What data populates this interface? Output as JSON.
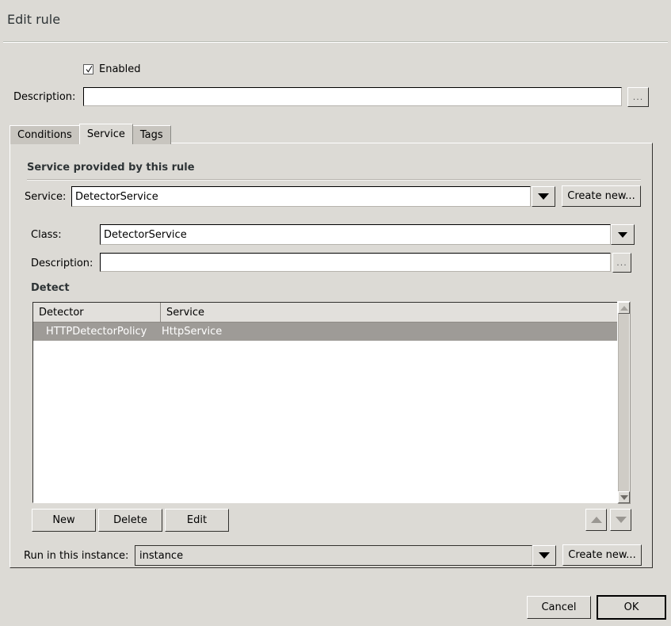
{
  "dialog": {
    "title": "Edit rule"
  },
  "header": {
    "enabled_label": "Enabled",
    "enabled_checked": true,
    "description_label": "Description:",
    "description_value": "",
    "description_browse_label": "...",
    "description_placeholder": ""
  },
  "tabs": [
    {
      "label": "Conditions",
      "active": false
    },
    {
      "label": "Service",
      "active": true
    },
    {
      "label": "Tags",
      "active": false
    }
  ],
  "service_tab": {
    "group_label": "Service provided by this rule",
    "service_label": "Service:",
    "service_value": "DetectorService",
    "service_create_new_label": "Create new...",
    "class_label": "Class:",
    "class_value": "DetectorService",
    "class_description_label": "Description:",
    "class_description_value": "",
    "class_description_browse_label": "...",
    "detect_label": "Detect",
    "detect_table": {
      "columns": [
        "Detector",
        "Service"
      ],
      "rows": [
        {
          "detector": "HTTPDetectorPolicy",
          "service": "HttpService",
          "selected": true
        }
      ]
    },
    "buttons": {
      "new_label": "New",
      "delete_label": "Delete",
      "edit_label": "Edit"
    },
    "instance_label": "Run in this instance:",
    "instance_value": "instance",
    "instance_create_new_label": "Create new..."
  },
  "footer": {
    "cancel_label": "Cancel",
    "ok_label": "OK"
  },
  "colors": {
    "dialog_background": "#dcdad5",
    "entry_background": "#ffffff",
    "selection_background": "#9e9b97",
    "selection_text": "#ffffff",
    "tab_inactive": "#c8c5bf",
    "border_dark": "#32312e",
    "text": "#000000"
  }
}
